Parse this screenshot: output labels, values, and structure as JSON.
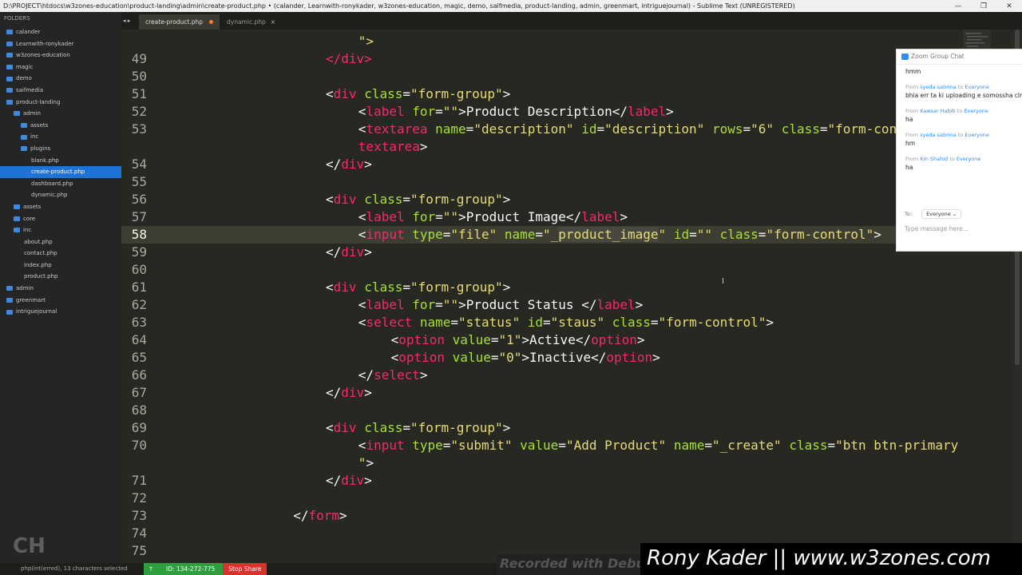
{
  "window": {
    "title": "D:\\PROJECT\\htdocs\\w3zones-education\\product-landing\\admin\\create-product.php • (calander, Learnwith-ronykader, w3zones-education, magic, demo, saifmedia, product-landing, admin, greenmart, intriguejournal) - Sublime Text (UNREGISTERED)",
    "minimize": "—",
    "restore": "❐",
    "close": "✕"
  },
  "sidebar": {
    "header": "FOLDERS",
    "items": [
      {
        "label": "calander",
        "indent": 0
      },
      {
        "label": "Learnwith-ronykader",
        "indent": 0
      },
      {
        "label": "w3zones-education",
        "indent": 0
      },
      {
        "label": "magic",
        "indent": 0
      },
      {
        "label": "demo",
        "indent": 0
      },
      {
        "label": "saifmedia",
        "indent": 0
      },
      {
        "label": "product-landing",
        "indent": 0
      },
      {
        "label": "admin",
        "indent": 1
      },
      {
        "label": "assets",
        "indent": 2
      },
      {
        "label": "inc",
        "indent": 2
      },
      {
        "label": "plugins",
        "indent": 2
      },
      {
        "label": "blank.php",
        "indent": 3,
        "file": true
      },
      {
        "label": "create-product.php",
        "indent": 3,
        "file": true,
        "selected": true
      },
      {
        "label": "dashboard.php",
        "indent": 3,
        "file": true
      },
      {
        "label": "dynamic.php",
        "indent": 3,
        "file": true
      },
      {
        "label": "assets",
        "indent": 1
      },
      {
        "label": "core",
        "indent": 1
      },
      {
        "label": "inc",
        "indent": 1
      },
      {
        "label": "about.php",
        "indent": 2,
        "file": true
      },
      {
        "label": "contact.php",
        "indent": 2,
        "file": true
      },
      {
        "label": "index.php",
        "indent": 2,
        "file": true
      },
      {
        "label": "product.php",
        "indent": 2,
        "file": true
      },
      {
        "label": "admin",
        "indent": 0
      },
      {
        "label": "greenmart",
        "indent": 0
      },
      {
        "label": "intriguejournal",
        "indent": 0
      }
    ]
  },
  "tabs": [
    {
      "label": "create-product.php",
      "active": true,
      "dirty": true
    },
    {
      "label": "dynamic.php",
      "active": false,
      "dirty": false
    }
  ],
  "tab_nav": "◂ ▸",
  "editor": {
    "current_line": 58,
    "lines": [
      {
        "num": "",
        "html": "<span class=\"s\">\"&gt;</span>",
        "indent": 12
      },
      {
        "num": "49",
        "html": "<span class=\"t\">&lt;/div&gt;</span>",
        "indent": 10
      },
      {
        "num": "50",
        "html": "",
        "indent": 0
      },
      {
        "num": "51",
        "html": "&lt;<span class=\"t\">div</span> <span class=\"a\">class</span>=<span class=\"s\">\"form-group\"</span>&gt;",
        "indent": 10
      },
      {
        "num": "52",
        "html": "&lt;<span class=\"t\">label</span> <span class=\"a\">for</span>=<span class=\"s\">\"\"</span>&gt;Product Description&lt;/<span class=\"t\">label</span>&gt;",
        "indent": 12
      },
      {
        "num": "53",
        "html": "&lt;<span class=\"t\">textarea</span> <span class=\"a\">name</span>=<span class=\"s\">\"description\"</span> <span class=\"a\">id</span>=<span class=\"s\">\"description\"</span> <span class=\"a\">rows</span>=<span class=\"s\">\"6\"</span> <span class=\"a\">class</span>=<span class=\"s\">\"form-control\"</span>&gt;&lt;/",
        "indent": 12
      },
      {
        "num": "",
        "html": "<span class=\"t\">textarea</span>&gt;",
        "indent": 12
      },
      {
        "num": "54",
        "html": "&lt;/<span class=\"t\">div</span>&gt;",
        "indent": 10
      },
      {
        "num": "55",
        "html": "",
        "indent": 0
      },
      {
        "num": "56",
        "html": "&lt;<span class=\"t\">div</span> <span class=\"a\">class</span>=<span class=\"s\">\"form-group\"</span>&gt;",
        "indent": 10
      },
      {
        "num": "57",
        "html": "&lt;<span class=\"t\">label</span> <span class=\"a\">for</span>=<span class=\"s\">\"\"</span>&gt;Product Image&lt;/<span class=\"t\">label</span>&gt;",
        "indent": 12
      },
      {
        "num": "58",
        "html": "&lt;<span class=\"t\">input</span> <span class=\"a\">type</span>=<span class=\"s\">\"file\"</span> <span class=\"a\">name</span>=<span class=\"s\">\"_<span class=\"hl\">product_image</span>\"</span> <span class=\"a\">id</span>=<span class=\"s\">\"\"</span> <span class=\"a\">class</span>=<span class=\"s\">\"form-control\"</span>&gt;",
        "indent": 12
      },
      {
        "num": "59",
        "html": "&lt;/<span class=\"t\">div</span>&gt;",
        "indent": 10
      },
      {
        "num": "60",
        "html": "",
        "indent": 0
      },
      {
        "num": "61",
        "html": "&lt;<span class=\"t\">div</span> <span class=\"a\">class</span>=<span class=\"s\">\"form-group\"</span>&gt;",
        "indent": 10
      },
      {
        "num": "62",
        "html": "&lt;<span class=\"t\">label</span> <span class=\"a\">for</span>=<span class=\"s\">\"\"</span>&gt;Product Status &lt;/<span class=\"t\">label</span>&gt;",
        "indent": 12
      },
      {
        "num": "63",
        "html": "&lt;<span class=\"t\">select</span> <span class=\"a\">name</span>=<span class=\"s\">\"status\"</span> <span class=\"a\">id</span>=<span class=\"s\">\"staus\"</span> <span class=\"a\">class</span>=<span class=\"s\">\"form-control\"</span>&gt;",
        "indent": 12
      },
      {
        "num": "64",
        "html": "&lt;<span class=\"t\">option</span> <span class=\"a\">value</span>=<span class=\"s\">\"1\"</span>&gt;Active&lt;/<span class=\"t\">option</span>&gt;",
        "indent": 14
      },
      {
        "num": "65",
        "html": "&lt;<span class=\"t\">option</span> <span class=\"a\">value</span>=<span class=\"s\">\"0\"</span>&gt;Inactive&lt;/<span class=\"t\">option</span>&gt;",
        "indent": 14
      },
      {
        "num": "66",
        "html": "&lt;/<span class=\"t\">select</span>&gt;",
        "indent": 12
      },
      {
        "num": "67",
        "html": "&lt;/<span class=\"t\">div</span>&gt;",
        "indent": 10
      },
      {
        "num": "68",
        "html": "",
        "indent": 0
      },
      {
        "num": "69",
        "html": "&lt;<span class=\"t\">div</span> <span class=\"a\">class</span>=<span class=\"s\">\"form-group\"</span>&gt;",
        "indent": 10
      },
      {
        "num": "70",
        "html": "&lt;<span class=\"t\">input</span> <span class=\"a\">type</span>=<span class=\"s\">\"submit\"</span> <span class=\"a\">value</span>=<span class=\"s\">\"Add Product\"</span> <span class=\"a\">name</span>=<span class=\"s\">\"_create\"</span> <span class=\"a\">class</span>=<span class=\"s\">\"btn btn-primary</span>",
        "indent": 12
      },
      {
        "num": "",
        "html": "<span class=\"s\">\"</span>&gt;",
        "indent": 12
      },
      {
        "num": "71",
        "html": "&lt;/<span class=\"t\">div</span>&gt;",
        "indent": 10
      },
      {
        "num": "72",
        "html": "",
        "indent": 0
      },
      {
        "num": "73",
        "html": "&lt;/<span class=\"t\">form</span>&gt;",
        "indent": 8
      },
      {
        "num": "74",
        "html": "",
        "indent": 0
      },
      {
        "num": "75",
        "html": "",
        "indent": 0
      }
    ]
  },
  "zoom_chat": {
    "title": "Zoom Group Chat",
    "messages": [
      {
        "from": "",
        "to": "",
        "text": "hmm"
      },
      {
        "from": "syeda sabrina",
        "to": "Everyone",
        "text": "bhia err ta ki uploading e somossha clr"
      },
      {
        "from": "Kawsar Habib",
        "to": "Everyone",
        "text": "ha"
      },
      {
        "from": "syeda sabrina",
        "to": "Everyone",
        "text": "hm"
      },
      {
        "from": "Km Shahid",
        "to": "Everyone",
        "text": "ha"
      }
    ],
    "from_word": "From",
    "to_word": "to",
    "to_label": "To:",
    "to_value": "Everyone ⌄",
    "input_placeholder": "Type message here..."
  },
  "status": {
    "text": "php(int(erred), 13 characters selected"
  },
  "zoom_bar": {
    "id_text": "ID: 134-272-775",
    "stop_label": "Stop Share"
  },
  "overlays": {
    "watermark": "Rony Kader || www.w3zones.com",
    "recorded": "Recorded with Debut"
  },
  "colors": {
    "editor_bg": "#272822",
    "tag": "#f92672",
    "attr": "#a6e22e",
    "string": "#e6db74",
    "selection": "#1e74d6"
  }
}
